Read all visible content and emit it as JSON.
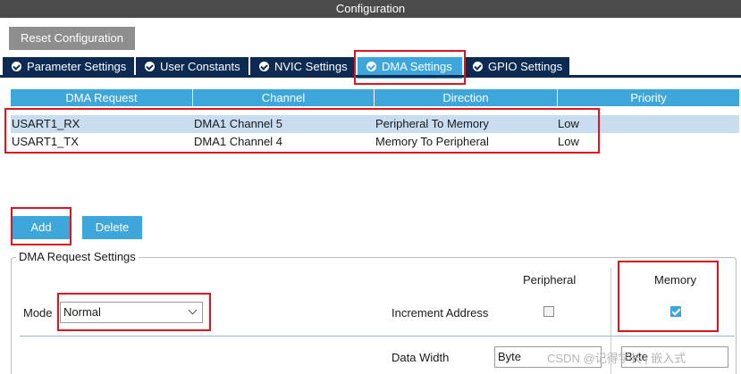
{
  "window": {
    "title": "Configuration"
  },
  "toolbar": {
    "reset_label": "Reset Configuration"
  },
  "tabs": [
    {
      "label": "Parameter Settings",
      "active": false
    },
    {
      "label": "User Constants",
      "active": false
    },
    {
      "label": "NVIC Settings",
      "active": false
    },
    {
      "label": "DMA Settings",
      "active": true
    },
    {
      "label": "GPIO Settings",
      "active": false
    }
  ],
  "dma_table": {
    "columns": [
      "DMA Request",
      "Channel",
      "Direction",
      "Priority"
    ],
    "rows": [
      {
        "request": "USART1_RX",
        "channel": "DMA1 Channel 5",
        "direction": "Peripheral To Memory",
        "priority": "Low",
        "selected": true
      },
      {
        "request": "USART1_TX",
        "channel": "DMA1 Channel 4",
        "direction": "Memory To Peripheral",
        "priority": "Low",
        "selected": false
      }
    ]
  },
  "actions": {
    "add_label": "Add",
    "delete_label": "Delete"
  },
  "request_settings": {
    "legend": "DMA Request Settings",
    "peripheral_header": "Peripheral",
    "memory_header": "Memory",
    "mode_label": "Mode",
    "mode_value": "Normal",
    "increment_label": "Increment Address",
    "peripheral_increment": false,
    "memory_increment": true,
    "data_width_label": "Data Width",
    "peripheral_data_width": "Byte",
    "memory_data_width": "Byte"
  },
  "watermark": {
    "text": "CSDN @记得学长 | 嵌入式"
  },
  "colors": {
    "accent": "#3da7dc",
    "tab_bg": "#0d2b52",
    "highlight": "#e0141e",
    "selected_row": "#c8ddf0"
  }
}
